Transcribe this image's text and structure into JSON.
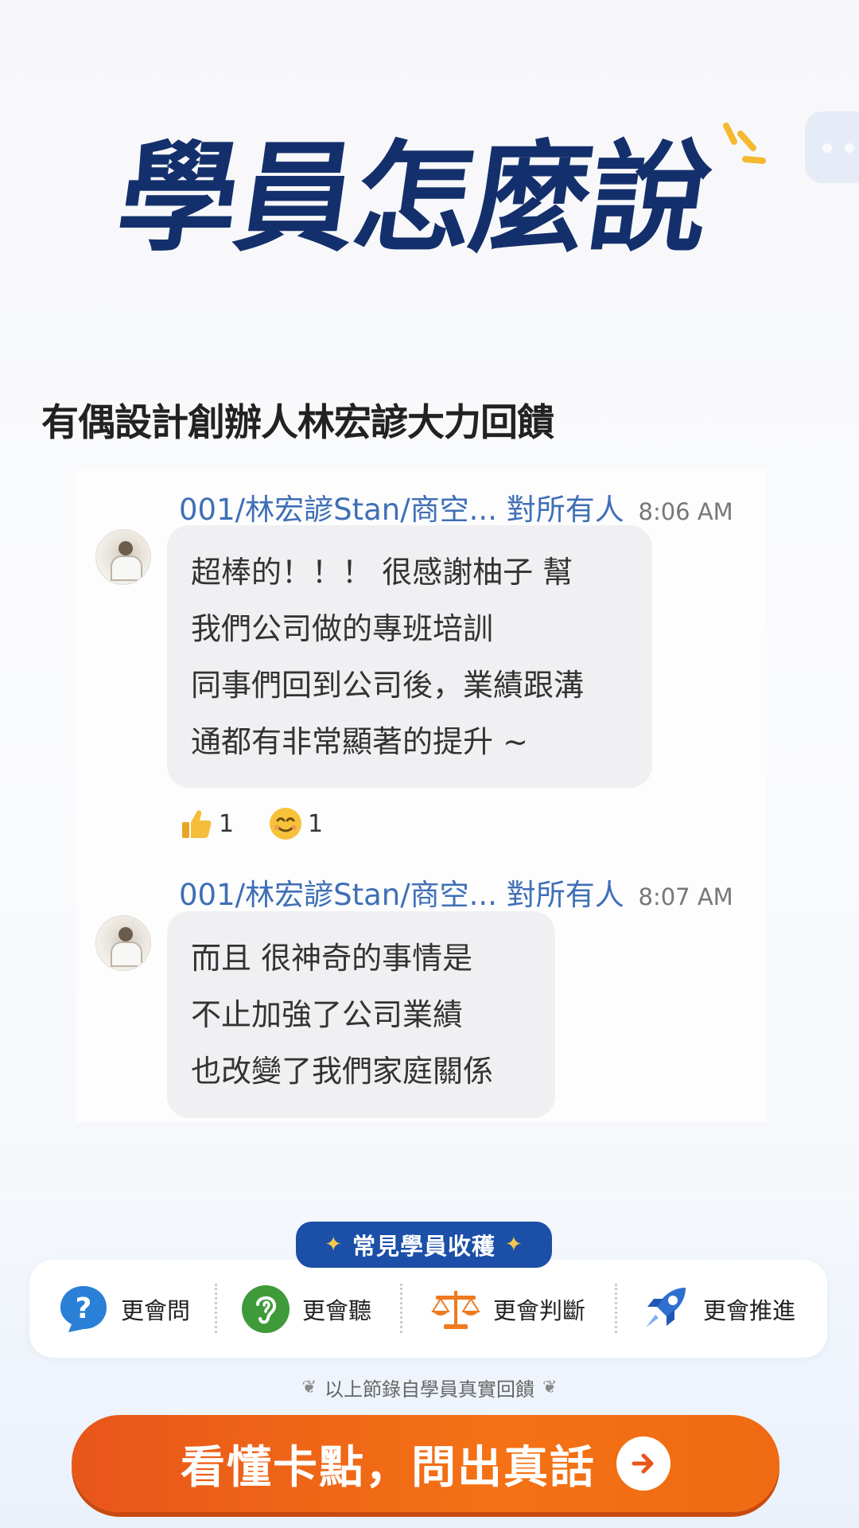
{
  "hero": {
    "title": "學員怎麼說"
  },
  "subtitle": "有偶設計創辦人林宏諺大力回饋",
  "messages": [
    {
      "sender": "001/林宏諺Stan/商空...",
      "target": "對所有人",
      "time": "8:06 AM",
      "lines": [
        "超棒的！！！ 很感謝柚子 幫",
        "我們公司做的專班培訓",
        "同事們回到公司後，業績跟溝",
        "通都有非常顯著的提升 ~"
      ]
    },
    {
      "sender": "001/林宏諺Stan/商空...",
      "target": "對所有人",
      "time": "8:07 AM",
      "lines": [
        "而且 很神奇的事情是",
        "不止加強了公司業績",
        "也改變了我們家庭關係"
      ]
    }
  ],
  "reactions": [
    {
      "icon": "thumbs-up-icon",
      "count": "1"
    },
    {
      "icon": "smile-icon",
      "count": "1"
    }
  ],
  "benefits": {
    "badge": "常見學員收穫",
    "items": [
      {
        "icon": "question-bubble-icon",
        "label": "更會問",
        "color": "#2a7fd6"
      },
      {
        "icon": "ear-icon",
        "label": "更會聽",
        "color": "#3f9a3a"
      },
      {
        "icon": "scales-icon",
        "label": "更會判斷",
        "color": "#ef7a1f"
      },
      {
        "icon": "rocket-icon",
        "label": "更會推進",
        "color": "#2f6fd0"
      }
    ]
  },
  "note": "以上節錄自學員真實回饋",
  "cta": {
    "label": "看懂卡點，問出真話"
  },
  "colors": {
    "brand_navy": "#14306c",
    "badge_blue": "#1b4fa8",
    "cta_orange": "#f26a14"
  }
}
